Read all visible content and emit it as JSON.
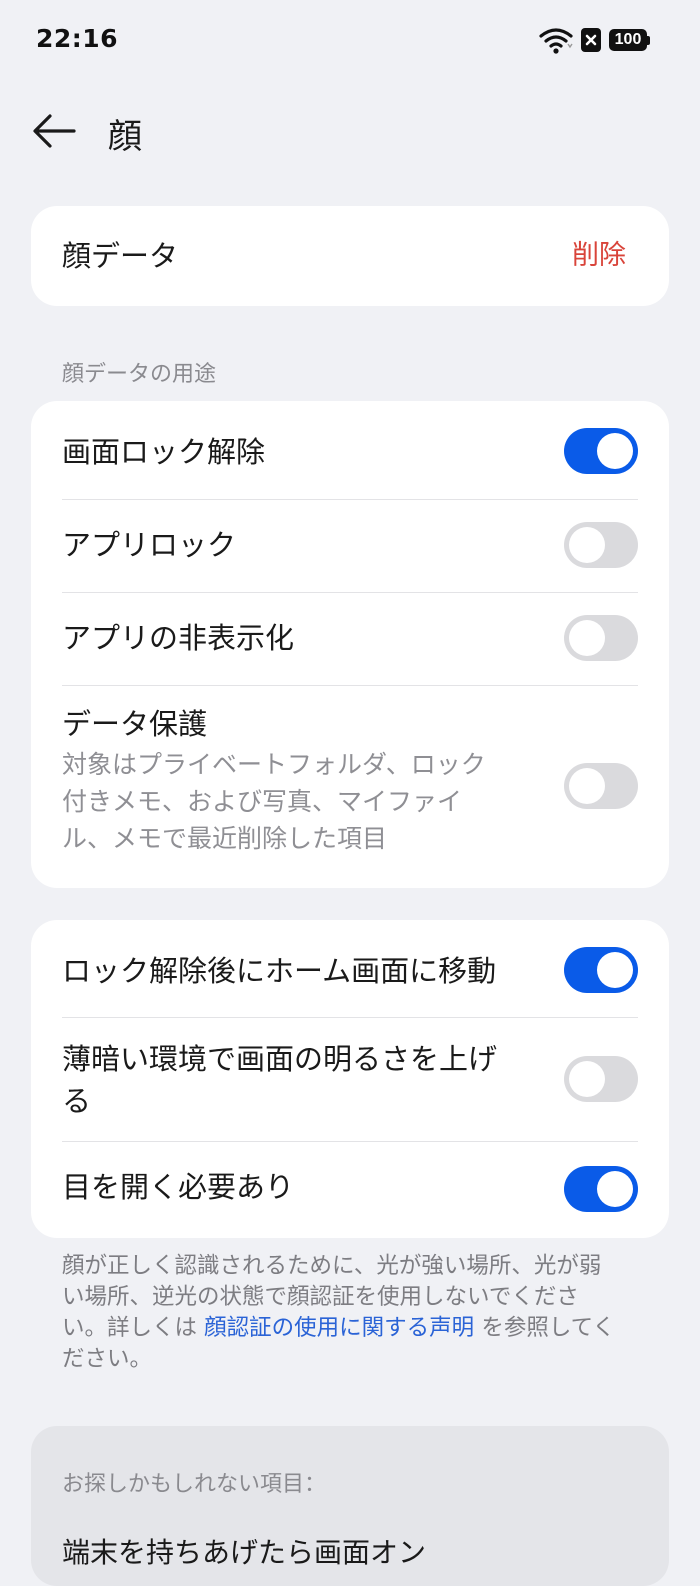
{
  "status_bar": {
    "time": "22:16",
    "battery": "100",
    "icons": [
      "wifi-icon",
      "sim-icon",
      "battery-icon"
    ]
  },
  "header": {
    "title": "顔",
    "back_icon": "arrow-left-icon"
  },
  "face_data_card": {
    "label": "顔データ",
    "delete_label": "削除"
  },
  "usage_section": {
    "label": "顔データの用途",
    "items": [
      {
        "label": "画面ロック解除",
        "enabled": true
      },
      {
        "label": "アプリロック",
        "enabled": false
      },
      {
        "label": "アプリの非表示化",
        "enabled": false
      },
      {
        "label": "データ保護",
        "description_lines": [
          "対象はプライベートフォルダ、ロック",
          "付きメモ、および写真、マイファイ",
          "ル、メモで最近削除した項目"
        ],
        "enabled": false
      }
    ]
  },
  "options_section": {
    "items": [
      {
        "label": "ロック解除後にホーム画面に移動",
        "enabled": true
      },
      {
        "label_lines": [
          "薄暗い環境で画面の明るさを上げ",
          "る"
        ],
        "enabled": false
      },
      {
        "label": "目を開く必要あり",
        "enabled": true
      }
    ]
  },
  "footnote": {
    "line1": "顔が正しく認識されるために、光が強い場所、光が弱",
    "line2": "い場所、逆光の状態で顔認証を使用しないでくださ",
    "line3_prefix": "い。詳しくは ",
    "link_text": "顔認証の使用に関する声明",
    "line3_suffix": " を参照してく",
    "line4": "ださい。"
  },
  "suggestions": {
    "title": "お探しかもしれない項目：",
    "items": [
      "端末を持ちあげたら画面オン"
    ]
  },
  "colors": {
    "accent": "#0A5BE8",
    "delete": "#D9443A",
    "link": "#2A63D6",
    "background": "#F0F1F5"
  }
}
